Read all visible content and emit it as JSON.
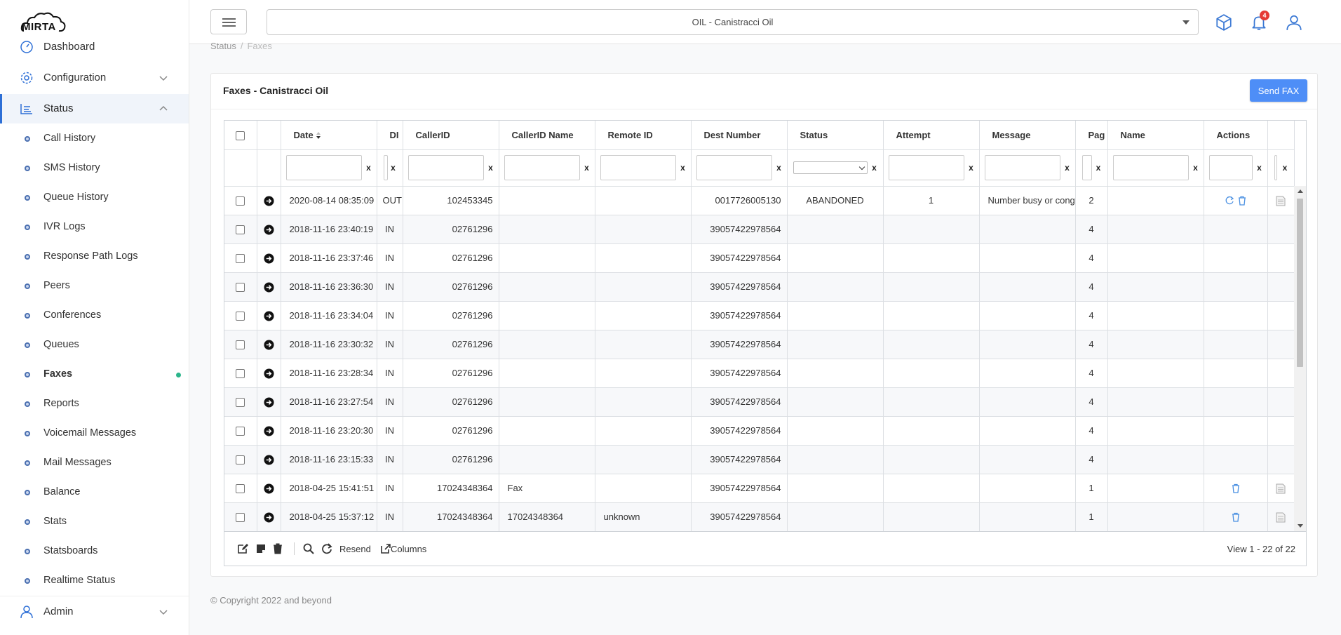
{
  "app": {
    "logo_text": "MIRTA"
  },
  "sidebar": {
    "top_items": [
      {
        "label": "Dashboard"
      },
      {
        "label": "Configuration"
      },
      {
        "label": "Status"
      }
    ],
    "status_items": [
      {
        "label": "Call History"
      },
      {
        "label": "SMS History"
      },
      {
        "label": "Queue History"
      },
      {
        "label": "IVR Logs"
      },
      {
        "label": "Response Path Logs"
      },
      {
        "label": "Peers"
      },
      {
        "label": "Conferences"
      },
      {
        "label": "Queues"
      },
      {
        "label": "Faxes"
      },
      {
        "label": "Reports"
      },
      {
        "label": "Voicemail Messages"
      },
      {
        "label": "Mail Messages"
      },
      {
        "label": "Balance"
      },
      {
        "label": "Stats"
      },
      {
        "label": "Statsboards"
      },
      {
        "label": "Realtime Status"
      }
    ],
    "admin_label": "Admin"
  },
  "header": {
    "tenant_selector": "OIL - Canistracci Oil",
    "notification_count": "4"
  },
  "breadcrumb": {
    "parent": "Status",
    "sep": "/",
    "current": "Faxes"
  },
  "card": {
    "title": "Faxes - Canistracci Oil",
    "send_button": "Send FAX"
  },
  "grid": {
    "columns": [
      "Date",
      "DI",
      "CallerID",
      "CallerID Name",
      "Remote ID",
      "Dest Number",
      "Status",
      "Attempt",
      "Message",
      "Pag",
      "Name",
      "Actions"
    ],
    "filter_clear": "x",
    "rows": [
      {
        "date": "2020-08-14 08:35:09",
        "dir": "OUT",
        "callerid": "102453345",
        "callerid_name": "",
        "remote_id": "",
        "dest": "0017726005130",
        "status": "ABANDONED",
        "attempt": "1",
        "message": "Number busy or cong",
        "pages": "2",
        "name": "",
        "actions": "resend-delete"
      },
      {
        "date": "2018-11-16 23:40:19",
        "dir": "IN",
        "callerid": "02761296",
        "callerid_name": "",
        "remote_id": "",
        "dest": "39057422978564",
        "status": "",
        "attempt": "",
        "message": "",
        "pages": "4",
        "name": "",
        "actions": ""
      },
      {
        "date": "2018-11-16 23:37:46",
        "dir": "IN",
        "callerid": "02761296",
        "callerid_name": "",
        "remote_id": "",
        "dest": "39057422978564",
        "status": "",
        "attempt": "",
        "message": "",
        "pages": "4",
        "name": "",
        "actions": ""
      },
      {
        "date": "2018-11-16 23:36:30",
        "dir": "IN",
        "callerid": "02761296",
        "callerid_name": "",
        "remote_id": "",
        "dest": "39057422978564",
        "status": "",
        "attempt": "",
        "message": "",
        "pages": "4",
        "name": "",
        "actions": ""
      },
      {
        "date": "2018-11-16 23:34:04",
        "dir": "IN",
        "callerid": "02761296",
        "callerid_name": "",
        "remote_id": "",
        "dest": "39057422978564",
        "status": "",
        "attempt": "",
        "message": "",
        "pages": "4",
        "name": "",
        "actions": ""
      },
      {
        "date": "2018-11-16 23:30:32",
        "dir": "IN",
        "callerid": "02761296",
        "callerid_name": "",
        "remote_id": "",
        "dest": "39057422978564",
        "status": "",
        "attempt": "",
        "message": "",
        "pages": "4",
        "name": "",
        "actions": ""
      },
      {
        "date": "2018-11-16 23:28:34",
        "dir": "IN",
        "callerid": "02761296",
        "callerid_name": "",
        "remote_id": "",
        "dest": "39057422978564",
        "status": "",
        "attempt": "",
        "message": "",
        "pages": "4",
        "name": "",
        "actions": ""
      },
      {
        "date": "2018-11-16 23:27:54",
        "dir": "IN",
        "callerid": "02761296",
        "callerid_name": "",
        "remote_id": "",
        "dest": "39057422978564",
        "status": "",
        "attempt": "",
        "message": "",
        "pages": "4",
        "name": "",
        "actions": ""
      },
      {
        "date": "2018-11-16 23:20:30",
        "dir": "IN",
        "callerid": "02761296",
        "callerid_name": "",
        "remote_id": "",
        "dest": "39057422978564",
        "status": "",
        "attempt": "",
        "message": "",
        "pages": "4",
        "name": "",
        "actions": ""
      },
      {
        "date": "2018-11-16 23:15:33",
        "dir": "IN",
        "callerid": "02761296",
        "callerid_name": "",
        "remote_id": "",
        "dest": "39057422978564",
        "status": "",
        "attempt": "",
        "message": "",
        "pages": "4",
        "name": "",
        "actions": ""
      },
      {
        "date": "2018-04-25 15:41:51",
        "dir": "IN",
        "callerid": "17024348364",
        "callerid_name": "Fax",
        "remote_id": "",
        "dest": "39057422978564",
        "status": "",
        "attempt": "",
        "message": "",
        "pages": "1",
        "name": "",
        "actions": "delete"
      },
      {
        "date": "2018-04-25 15:37:12",
        "dir": "IN",
        "callerid": "17024348364",
        "callerid_name": "17024348364",
        "remote_id": "unknown",
        "dest": "39057422978564",
        "status": "",
        "attempt": "",
        "message": "",
        "pages": "1",
        "name": "",
        "actions": "delete"
      }
    ],
    "pager": {
      "resend_label": "Resend",
      "columns_label": "Columns",
      "view_text": "View 1 - 22 of 22"
    }
  },
  "footer": {
    "copyright": "© Copyright 2022 and beyond"
  },
  "colors": {
    "accent": "#2d6fd6",
    "button": "#4e8ef7",
    "active_dot": "#2bb58b",
    "badge": "#e53935"
  }
}
